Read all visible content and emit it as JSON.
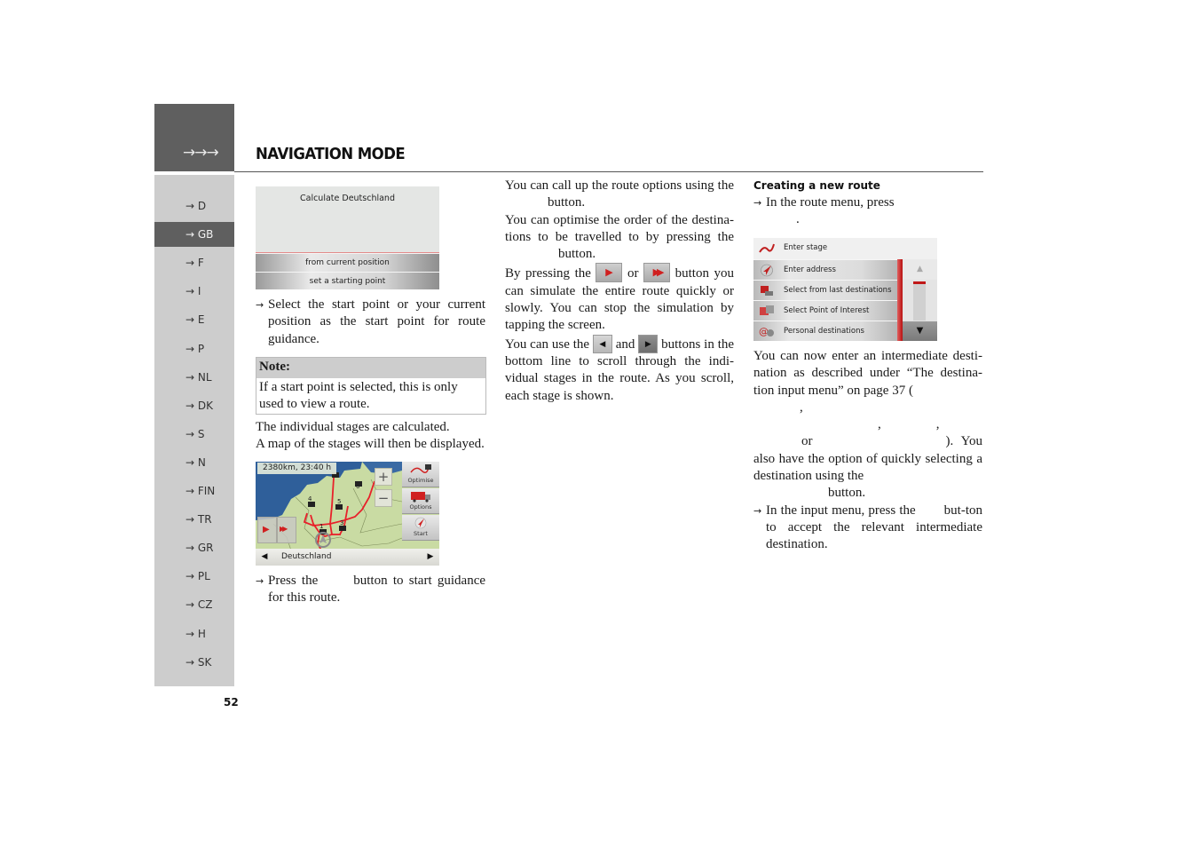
{
  "header": {
    "arrows": "→→→",
    "title": "NAVIGATION MODE"
  },
  "sidebar": {
    "items": [
      {
        "label": "→ D",
        "active": false
      },
      {
        "label": "→ GB",
        "active": true
      },
      {
        "label": "→ F",
        "active": false
      },
      {
        "label": "→ I",
        "active": false
      },
      {
        "label": "→ E",
        "active": false
      },
      {
        "label": "→ P",
        "active": false
      },
      {
        "label": "→ NL",
        "active": false
      },
      {
        "label": "→ DK",
        "active": false
      },
      {
        "label": "→ S",
        "active": false
      },
      {
        "label": "→ N",
        "active": false
      },
      {
        "label": "→ FIN",
        "active": false
      },
      {
        "label": "→ TR",
        "active": false
      },
      {
        "label": "→ GR",
        "active": false
      },
      {
        "label": "→ PL",
        "active": false
      },
      {
        "label": "→ CZ",
        "active": false
      },
      {
        "label": "→ H",
        "active": false
      },
      {
        "label": "→ SK",
        "active": false
      }
    ]
  },
  "page_number": "52",
  "column1": {
    "screen_calculate": {
      "title": "Calculate Deutschland",
      "buttons": [
        "from current position",
        "set a starting point"
      ]
    },
    "step1": "Select the start point or your current position as the start point for route guidance.",
    "note": {
      "heading": "Note:",
      "text": "If a start point is selected, this is only used to view a route."
    },
    "para1": "The individual stages are calculated.",
    "para2": "A map of the stages will then be displayed.",
    "map_screen": {
      "info": "2380km,  23:40 h",
      "zoom_in": "+",
      "zoom_out": "−",
      "buttons": [
        "Optimise",
        "Options",
        "Start"
      ],
      "stage_numbers": [
        "1",
        "3",
        "4",
        "5",
        "6"
      ],
      "bottom_label": "Deutschland",
      "prev_arrow": "◀",
      "next_arrow": "▶"
    },
    "step2_a": "Press the",
    "step2_b": "button to start guidance for this route."
  },
  "column2": {
    "p1_a": "You can call up the route options using the",
    "p1_b": "button.",
    "p2_a": "You can optimise the order of the destina-tions to be travelled to by pressing the",
    "p2_b": "button.",
    "p3_a": "By pressing the",
    "p3_or": "or",
    "p3_b": "button you can simulate the entire route quickly or slowly. You can stop the simulation by tapping the screen.",
    "p4_a": "You can use the",
    "p4_and": "and",
    "p4_b": "buttons in the bottom line to scroll through the indi-vidual stages in the route. As you scroll, each stage is shown.",
    "icons": {
      "play": "▶",
      "fast_forward": "▶▶",
      "left": "◀",
      "right": "▶"
    }
  },
  "column3": {
    "subheading": "Creating a new route",
    "step1": "In the route menu, press",
    "step1_end": ".",
    "route_menu": {
      "items": [
        "Enter stage",
        "Enter address",
        "Select from last destinations",
        "Select Point of Interest",
        "Personal destinations"
      ],
      "scroll_up": "▲",
      "scroll_down": "▼"
    },
    "p1": "You can now enter an intermediate desti-nation as described under “The destina-tion input menu” on page 37 (",
    "p1_comma1": ",",
    "p1_comma2": ",",
    "p1_comma3": ",",
    "p1_or": "or",
    "p1_end": "). You also have the option of quickly selecting a destination using the",
    "p1_button": "button.",
    "step2_a": "In the input menu, press the",
    "step2_b": "but-ton to accept the relevant intermediate destination."
  }
}
